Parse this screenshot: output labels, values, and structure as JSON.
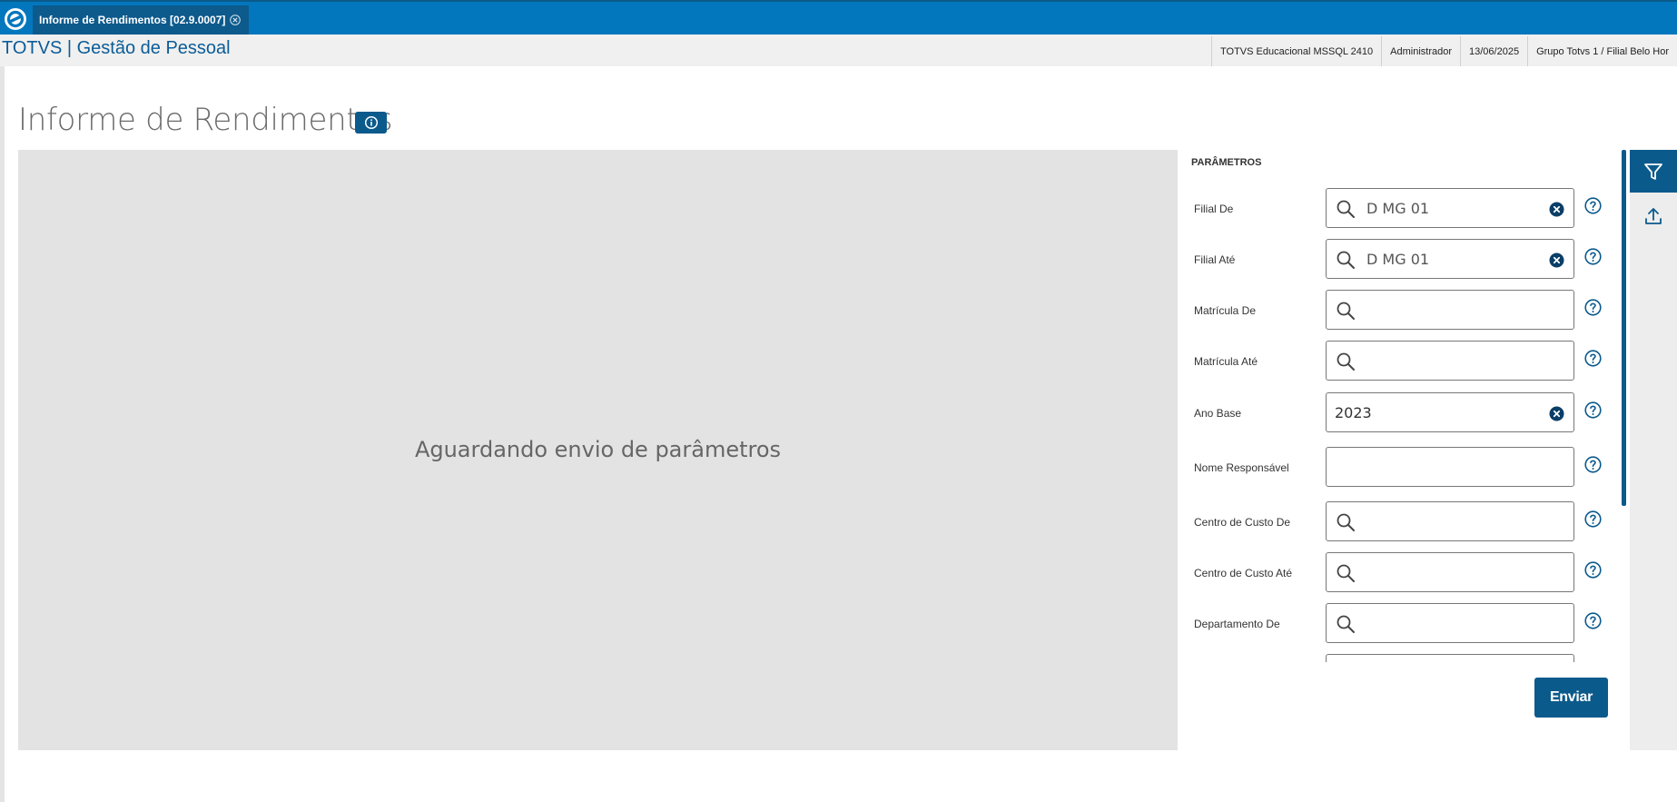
{
  "tab": {
    "title": "Informe de Rendimentos [02.9.0007]"
  },
  "app": {
    "title": "TOTVS | Gestão de Pessoal"
  },
  "status": [
    "TOTVS Educacional MSSQL 2410",
    "Administrador",
    "13/06/2025",
    "Grupo Totvs 1 / Filial Belo Hor"
  ],
  "page": {
    "title": "Informe de Rendimentos"
  },
  "preview": {
    "message": "Aguardando envio de parâmetros"
  },
  "params": {
    "title": "PARÂMETROS",
    "fields": [
      {
        "label": "Filial De",
        "value": "D MG 01",
        "search": true,
        "clear": true
      },
      {
        "label": "Filial Até",
        "value": "D MG 01",
        "search": true,
        "clear": true
      },
      {
        "label": "Matrícula De",
        "value": "",
        "search": true,
        "clear": false
      },
      {
        "label": "Matrícula Até",
        "value": "",
        "search": true,
        "clear": false
      },
      {
        "label": "Ano Base",
        "value": "2023",
        "search": false,
        "clear": true
      },
      {
        "label": "Nome Responsável",
        "value": "",
        "search": false,
        "clear": false
      },
      {
        "label": "Centro de Custo De",
        "value": "",
        "search": true,
        "clear": false
      },
      {
        "label": "Centro de Custo Até",
        "value": "",
        "search": true,
        "clear": false
      },
      {
        "label": "Departamento De",
        "value": "",
        "search": true,
        "clear": false
      }
    ],
    "send_label": "Enviar"
  },
  "colors": {
    "primary": "#0b5a8c",
    "topbar": "#0277bd",
    "preview_bg": "#e3e3e3"
  },
  "icons": {
    "filter": "filter-icon",
    "upload": "upload-icon",
    "info": "info-icon",
    "search": "search-icon",
    "clear": "clear-icon",
    "help": "help-icon"
  }
}
